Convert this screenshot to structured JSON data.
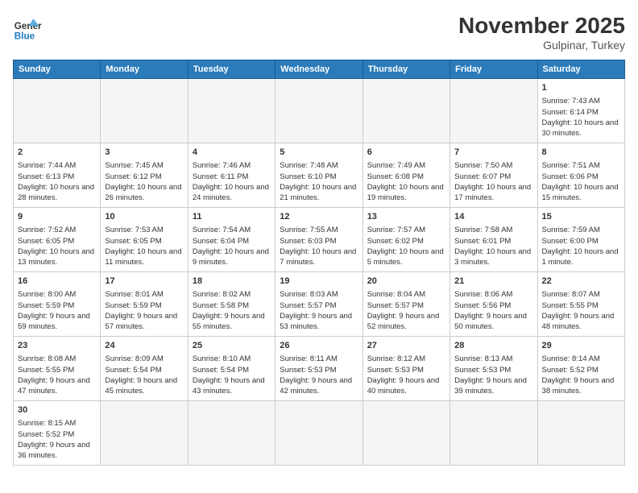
{
  "header": {
    "logo_general": "General",
    "logo_blue": "Blue",
    "month_title": "November 2025",
    "subtitle": "Gulpinar, Turkey"
  },
  "days_of_week": [
    "Sunday",
    "Monday",
    "Tuesday",
    "Wednesday",
    "Thursday",
    "Friday",
    "Saturday"
  ],
  "weeks": [
    [
      {
        "day": "",
        "sunrise": "",
        "sunset": "",
        "daylight": "",
        "empty": true
      },
      {
        "day": "",
        "sunrise": "",
        "sunset": "",
        "daylight": "",
        "empty": true
      },
      {
        "day": "",
        "sunrise": "",
        "sunset": "",
        "daylight": "",
        "empty": true
      },
      {
        "day": "",
        "sunrise": "",
        "sunset": "",
        "daylight": "",
        "empty": true
      },
      {
        "day": "",
        "sunrise": "",
        "sunset": "",
        "daylight": "",
        "empty": true
      },
      {
        "day": "",
        "sunrise": "",
        "sunset": "",
        "daylight": "",
        "empty": true
      },
      {
        "day": "1",
        "sunrise": "Sunrise: 7:43 AM",
        "sunset": "Sunset: 6:14 PM",
        "daylight": "Daylight: 10 hours and 30 minutes.",
        "empty": false
      }
    ],
    [
      {
        "day": "2",
        "sunrise": "Sunrise: 7:44 AM",
        "sunset": "Sunset: 6:13 PM",
        "daylight": "Daylight: 10 hours and 28 minutes.",
        "empty": false
      },
      {
        "day": "3",
        "sunrise": "Sunrise: 7:45 AM",
        "sunset": "Sunset: 6:12 PM",
        "daylight": "Daylight: 10 hours and 26 minutes.",
        "empty": false
      },
      {
        "day": "4",
        "sunrise": "Sunrise: 7:46 AM",
        "sunset": "Sunset: 6:11 PM",
        "daylight": "Daylight: 10 hours and 24 minutes.",
        "empty": false
      },
      {
        "day": "5",
        "sunrise": "Sunrise: 7:48 AM",
        "sunset": "Sunset: 6:10 PM",
        "daylight": "Daylight: 10 hours and 21 minutes.",
        "empty": false
      },
      {
        "day": "6",
        "sunrise": "Sunrise: 7:49 AM",
        "sunset": "Sunset: 6:08 PM",
        "daylight": "Daylight: 10 hours and 19 minutes.",
        "empty": false
      },
      {
        "day": "7",
        "sunrise": "Sunrise: 7:50 AM",
        "sunset": "Sunset: 6:07 PM",
        "daylight": "Daylight: 10 hours and 17 minutes.",
        "empty": false
      },
      {
        "day": "8",
        "sunrise": "Sunrise: 7:51 AM",
        "sunset": "Sunset: 6:06 PM",
        "daylight": "Daylight: 10 hours and 15 minutes.",
        "empty": false
      }
    ],
    [
      {
        "day": "9",
        "sunrise": "Sunrise: 7:52 AM",
        "sunset": "Sunset: 6:05 PM",
        "daylight": "Daylight: 10 hours and 13 minutes.",
        "empty": false
      },
      {
        "day": "10",
        "sunrise": "Sunrise: 7:53 AM",
        "sunset": "Sunset: 6:05 PM",
        "daylight": "Daylight: 10 hours and 11 minutes.",
        "empty": false
      },
      {
        "day": "11",
        "sunrise": "Sunrise: 7:54 AM",
        "sunset": "Sunset: 6:04 PM",
        "daylight": "Daylight: 10 hours and 9 minutes.",
        "empty": false
      },
      {
        "day": "12",
        "sunrise": "Sunrise: 7:55 AM",
        "sunset": "Sunset: 6:03 PM",
        "daylight": "Daylight: 10 hours and 7 minutes.",
        "empty": false
      },
      {
        "day": "13",
        "sunrise": "Sunrise: 7:57 AM",
        "sunset": "Sunset: 6:02 PM",
        "daylight": "Daylight: 10 hours and 5 minutes.",
        "empty": false
      },
      {
        "day": "14",
        "sunrise": "Sunrise: 7:58 AM",
        "sunset": "Sunset: 6:01 PM",
        "daylight": "Daylight: 10 hours and 3 minutes.",
        "empty": false
      },
      {
        "day": "15",
        "sunrise": "Sunrise: 7:59 AM",
        "sunset": "Sunset: 6:00 PM",
        "daylight": "Daylight: 10 hours and 1 minute.",
        "empty": false
      }
    ],
    [
      {
        "day": "16",
        "sunrise": "Sunrise: 8:00 AM",
        "sunset": "Sunset: 5:59 PM",
        "daylight": "Daylight: 9 hours and 59 minutes.",
        "empty": false
      },
      {
        "day": "17",
        "sunrise": "Sunrise: 8:01 AM",
        "sunset": "Sunset: 5:59 PM",
        "daylight": "Daylight: 9 hours and 57 minutes.",
        "empty": false
      },
      {
        "day": "18",
        "sunrise": "Sunrise: 8:02 AM",
        "sunset": "Sunset: 5:58 PM",
        "daylight": "Daylight: 9 hours and 55 minutes.",
        "empty": false
      },
      {
        "day": "19",
        "sunrise": "Sunrise: 8:03 AM",
        "sunset": "Sunset: 5:57 PM",
        "daylight": "Daylight: 9 hours and 53 minutes.",
        "empty": false
      },
      {
        "day": "20",
        "sunrise": "Sunrise: 8:04 AM",
        "sunset": "Sunset: 5:57 PM",
        "daylight": "Daylight: 9 hours and 52 minutes.",
        "empty": false
      },
      {
        "day": "21",
        "sunrise": "Sunrise: 8:06 AM",
        "sunset": "Sunset: 5:56 PM",
        "daylight": "Daylight: 9 hours and 50 minutes.",
        "empty": false
      },
      {
        "day": "22",
        "sunrise": "Sunrise: 8:07 AM",
        "sunset": "Sunset: 5:55 PM",
        "daylight": "Daylight: 9 hours and 48 minutes.",
        "empty": false
      }
    ],
    [
      {
        "day": "23",
        "sunrise": "Sunrise: 8:08 AM",
        "sunset": "Sunset: 5:55 PM",
        "daylight": "Daylight: 9 hours and 47 minutes.",
        "empty": false
      },
      {
        "day": "24",
        "sunrise": "Sunrise: 8:09 AM",
        "sunset": "Sunset: 5:54 PM",
        "daylight": "Daylight: 9 hours and 45 minutes.",
        "empty": false
      },
      {
        "day": "25",
        "sunrise": "Sunrise: 8:10 AM",
        "sunset": "Sunset: 5:54 PM",
        "daylight": "Daylight: 9 hours and 43 minutes.",
        "empty": false
      },
      {
        "day": "26",
        "sunrise": "Sunrise: 8:11 AM",
        "sunset": "Sunset: 5:53 PM",
        "daylight": "Daylight: 9 hours and 42 minutes.",
        "empty": false
      },
      {
        "day": "27",
        "sunrise": "Sunrise: 8:12 AM",
        "sunset": "Sunset: 5:53 PM",
        "daylight": "Daylight: 9 hours and 40 minutes.",
        "empty": false
      },
      {
        "day": "28",
        "sunrise": "Sunrise: 8:13 AM",
        "sunset": "Sunset: 5:53 PM",
        "daylight": "Daylight: 9 hours and 39 minutes.",
        "empty": false
      },
      {
        "day": "29",
        "sunrise": "Sunrise: 8:14 AM",
        "sunset": "Sunset: 5:52 PM",
        "daylight": "Daylight: 9 hours and 38 minutes.",
        "empty": false
      }
    ],
    [
      {
        "day": "30",
        "sunrise": "Sunrise: 8:15 AM",
        "sunset": "Sunset: 5:52 PM",
        "daylight": "Daylight: 9 hours and 36 minutes.",
        "empty": false
      },
      {
        "day": "",
        "sunrise": "",
        "sunset": "",
        "daylight": "",
        "empty": true
      },
      {
        "day": "",
        "sunrise": "",
        "sunset": "",
        "daylight": "",
        "empty": true
      },
      {
        "day": "",
        "sunrise": "",
        "sunset": "",
        "daylight": "",
        "empty": true
      },
      {
        "day": "",
        "sunrise": "",
        "sunset": "",
        "daylight": "",
        "empty": true
      },
      {
        "day": "",
        "sunrise": "",
        "sunset": "",
        "daylight": "",
        "empty": true
      },
      {
        "day": "",
        "sunrise": "",
        "sunset": "",
        "daylight": "",
        "empty": true
      }
    ]
  ]
}
